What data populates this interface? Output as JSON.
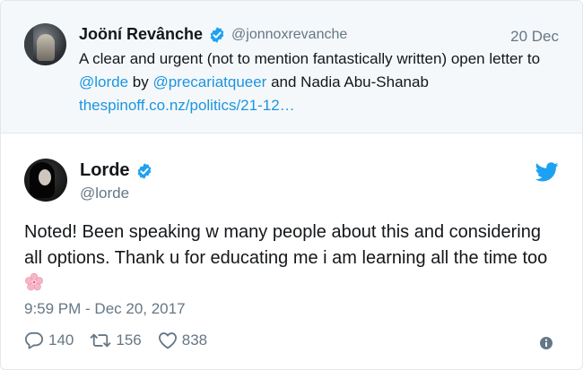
{
  "parent_tweet": {
    "display_name": "Joöní Revânche",
    "handle": "@jonnoxrevanche",
    "date": "20 Dec",
    "text_segments": [
      {
        "text": "A clear and urgent (not to mention fantastically written) open letter to ",
        "link": false
      },
      {
        "text": "@lorde",
        "link": true
      },
      {
        "text": " by ",
        "link": false
      },
      {
        "text": "@precariatqueer",
        "link": true
      },
      {
        "text": " and Nadia Abu-Shanab ",
        "link": false
      },
      {
        "text": "thespinoff.co.nz/politics/21-12…",
        "link": true
      }
    ]
  },
  "tweet": {
    "display_name": "Lorde",
    "handle": "@lorde",
    "text": "Noted! Been speaking w many people about this and considering all options. Thank u for educating me i am learning all the time too ",
    "timestamp": "9:59 PM - Dec 20, 2017",
    "reply_count": "140",
    "retweet_count": "156",
    "like_count": "838"
  },
  "icons": {
    "verified": "verified-badge-icon",
    "bird": "twitter-bird-icon",
    "reply": "reply-icon",
    "retweet": "retweet-icon",
    "like": "heart-icon",
    "info": "info-icon",
    "emoji": "cherry-blossom-emoji"
  },
  "colors": {
    "link": "#1b95e0",
    "secondary_text": "#657786",
    "parent_background": "#f5f8fa",
    "verified": "#1da1f2"
  }
}
